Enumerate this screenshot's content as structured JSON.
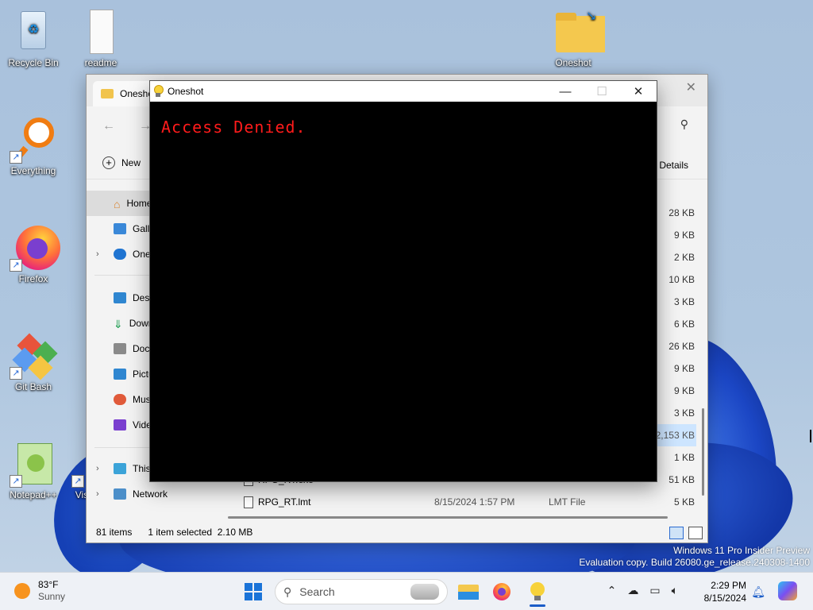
{
  "desktop": {
    "icons": [
      {
        "label": "Recycle Bin"
      },
      {
        "label": "readme"
      },
      {
        "label": "Oneshot"
      },
      {
        "label": "Everything"
      },
      {
        "label": "Firefox"
      },
      {
        "label": "Git Bash"
      },
      {
        "label": "Notepad++"
      },
      {
        "label": "Vis"
      }
    ]
  },
  "explorer": {
    "tab_title": "Oneshot",
    "new_label": "New",
    "details_label": "Details",
    "nav": [
      {
        "label": "Home"
      },
      {
        "label": "Gallery"
      },
      {
        "label": "OneDrive"
      },
      {
        "label": "Desktop"
      },
      {
        "label": "Downloads"
      },
      {
        "label": "Documents"
      },
      {
        "label": "Pictures"
      },
      {
        "label": "Music"
      },
      {
        "label": "Videos"
      },
      {
        "label": "This PC"
      },
      {
        "label": "Network"
      }
    ],
    "sizes": [
      "28 KB",
      "9 KB",
      "2 KB",
      "10 KB",
      "3 KB",
      "6 KB",
      "26 KB",
      "9 KB",
      "9 KB",
      "3 KB",
      "2,153 KB",
      "1 KB",
      "51 KB"
    ],
    "last_file": {
      "name": "RPG_RT.lmt",
      "date": "8/15/2024 1:57 PM",
      "type": "LMT File",
      "size": "5 KB"
    },
    "partial_file": "RPG_RT.exe",
    "status": {
      "count": "81 items",
      "selection": "1 item selected  2.10 MB"
    }
  },
  "oneshot": {
    "title": "Oneshot",
    "message": "Access Denied."
  },
  "watermark": {
    "line1": "Windows 11 Pro Insider Preview",
    "line2": "Evaluation copy. Build 26080.ge_release.240308-1400"
  },
  "taskbar": {
    "temp": "83°F",
    "condition": "Sunny",
    "search_placeholder": "Search",
    "time": "2:29 PM",
    "date": "8/15/2024"
  }
}
